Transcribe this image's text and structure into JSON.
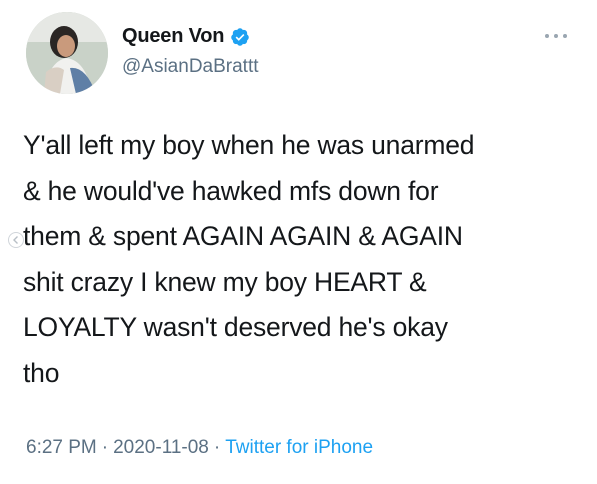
{
  "user": {
    "display_name": "Queen Von",
    "handle": "@AsianDaBrattt",
    "verified": true,
    "avatar_icon": "profile-photo"
  },
  "tweet": {
    "lines": [
      "Y'all left my boy when he was unarmed",
      "& he would've hawked mfs down for",
      "them & spent AGAIN AGAIN & AGAIN",
      "shit crazy I knew my boy HEART &",
      "LOYALTY wasn't deserved he's okay",
      "tho"
    ]
  },
  "meta": {
    "time": "6:27 PM",
    "separator": "·",
    "date": "2020-11-08",
    "source": "Twitter for iPhone"
  },
  "colors": {
    "text": "#14171a",
    "secondary": "#5b7083",
    "link": "#1da1f2",
    "verified": "#1da1f2"
  }
}
